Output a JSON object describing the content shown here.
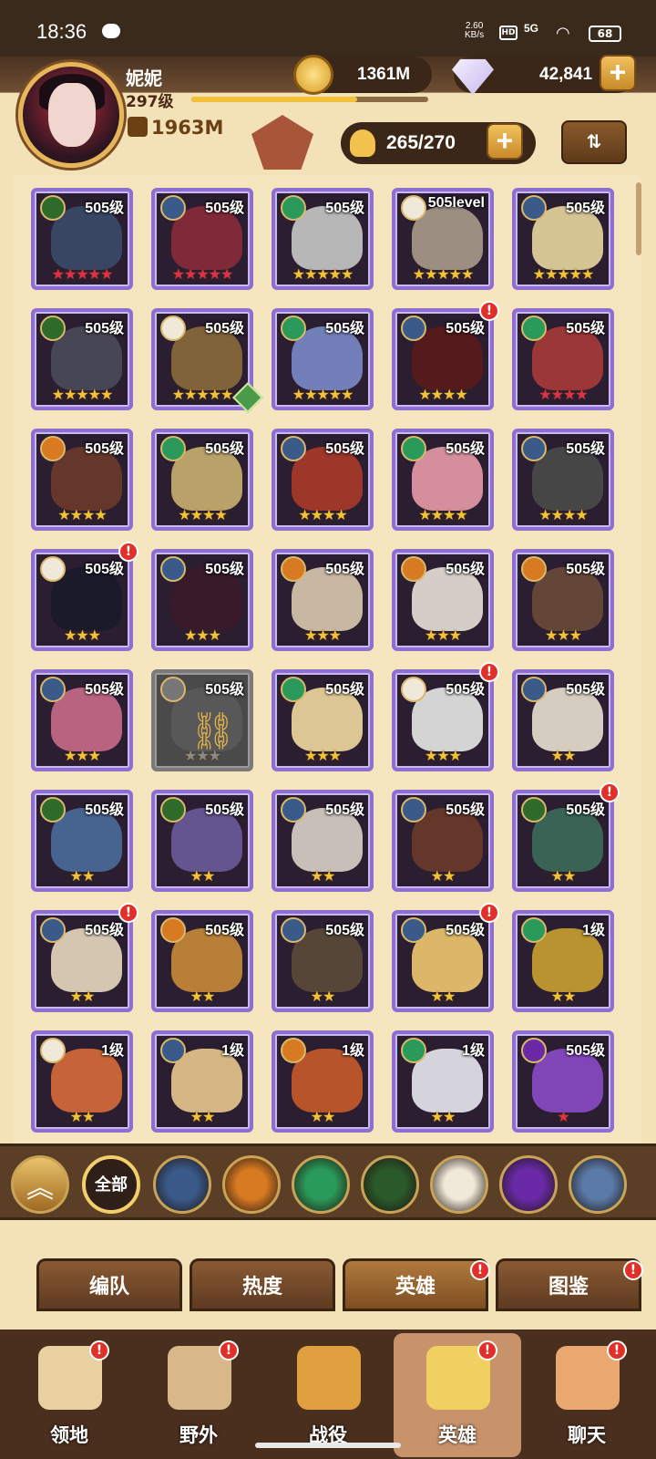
{
  "status_bar": {
    "time": "18:36",
    "net_speed": "2.60",
    "net_unit": "KB/s",
    "hd": "HD",
    "network": "5G",
    "battery": "68"
  },
  "player": {
    "name": "妮妮",
    "level": "297级",
    "exp_fraction": 0.7,
    "power": "1963M"
  },
  "resources": {
    "gold": "1361M",
    "diamonds": "42,841",
    "hero_count": "265/270"
  },
  "heroes": [
    {
      "level": "505级",
      "stars": "★★★★★",
      "star_color": "red",
      "faction": "forest",
      "color": "#3a4a6a",
      "alert": false
    },
    {
      "level": "505级",
      "stars": "★★★★★",
      "star_color": "red",
      "faction": "lightbearer",
      "color": "#8a2a3a",
      "alert": false
    },
    {
      "level": "505级",
      "stars": "★★★★★",
      "star_color": "gold",
      "faction": "wilder",
      "color": "#c8c8c8",
      "alert": false
    },
    {
      "level": "505level",
      "stars": "★★★★★",
      "star_color": "gold",
      "faction": "celestial",
      "color": "#a89a8a",
      "alert": false
    },
    {
      "level": "505级",
      "stars": "★★★★★",
      "star_color": "gold",
      "faction": "lightbearer",
      "color": "#e8d6a0",
      "alert": false
    },
    {
      "level": "505级",
      "stars": "★★★★★",
      "star_color": "gold",
      "faction": "forest",
      "color": "#4a4a5a",
      "alert": false
    },
    {
      "level": "505级",
      "stars": "★★★★★",
      "star_color": "gold",
      "faction": "celestial",
      "color": "#8a6a3a",
      "alert": false,
      "hourglass": true
    },
    {
      "level": "505级",
      "stars": "★★★★★",
      "star_color": "gold",
      "faction": "wilder",
      "color": "#7a8ac8",
      "alert": false
    },
    {
      "level": "505级",
      "stars": "★★★★",
      "star_color": "gold",
      "faction": "lightbearer",
      "color": "#5a1a1a",
      "alert": true
    },
    {
      "level": "505级",
      "stars": "★★★★",
      "star_color": "red",
      "faction": "wilder",
      "color": "#a83a3a",
      "alert": false
    },
    {
      "level": "505级",
      "stars": "★★★★",
      "star_color": "gold",
      "faction": "graveborn",
      "color": "#6a3a2a",
      "alert": false
    },
    {
      "level": "505级",
      "stars": "★★★★",
      "star_color": "gold",
      "faction": "wilder",
      "color": "#c8b070",
      "alert": false
    },
    {
      "level": "505级",
      "stars": "★★★★",
      "star_color": "gold",
      "faction": "lightbearer",
      "color": "#a83a2a",
      "alert": false
    },
    {
      "level": "505级",
      "stars": "★★★★",
      "star_color": "gold",
      "faction": "wilder",
      "color": "#e89aa8",
      "alert": false
    },
    {
      "level": "505级",
      "stars": "★★★★",
      "star_color": "gold",
      "faction": "lightbearer",
      "color": "#4a4a4a",
      "alert": false
    },
    {
      "level": "505级",
      "stars": "★★★",
      "star_color": "gold",
      "faction": "celestial",
      "color": "#1a1a2a",
      "alert": true
    },
    {
      "level": "505级",
      "stars": "★★★",
      "star_color": "gold",
      "faction": "lightbearer",
      "color": "#3a1a2a",
      "alert": false
    },
    {
      "level": "505级",
      "stars": "★★★",
      "star_color": "gold",
      "faction": "graveborn",
      "color": "#d8c8b0",
      "alert": false
    },
    {
      "level": "505级",
      "stars": "★★★",
      "star_color": "gold",
      "faction": "graveborn",
      "color": "#e8e0d8",
      "alert": false
    },
    {
      "level": "505级",
      "stars": "★★★",
      "star_color": "gold",
      "faction": "graveborn",
      "color": "#6a4a3a",
      "alert": false
    },
    {
      "level": "505级",
      "stars": "★★★",
      "star_color": "gold",
      "faction": "lightbearer",
      "color": "#c86a8a",
      "alert": false
    },
    {
      "level": "505级",
      "stars": "★★★",
      "star_color": "gray",
      "faction": "locked",
      "color": "#5a5a5a",
      "alert": false,
      "locked": true
    },
    {
      "level": "505级",
      "stars": "★★★",
      "star_color": "gold",
      "faction": "wilder",
      "color": "#f0d8a0",
      "alert": false
    },
    {
      "level": "505级",
      "stars": "★★★",
      "star_color": "gold",
      "faction": "celestial",
      "color": "#e8e8e8",
      "alert": true
    },
    {
      "level": "505级",
      "stars": "★★",
      "star_color": "gold",
      "faction": "lightbearer",
      "color": "#e8e0d0",
      "alert": false
    },
    {
      "level": "505级",
      "stars": "★★",
      "star_color": "gold",
      "faction": "forest",
      "color": "#4a6a9a",
      "alert": false
    },
    {
      "level": "505级",
      "stars": "★★",
      "star_color": "gold",
      "faction": "forest",
      "color": "#6a5a9a",
      "alert": false
    },
    {
      "level": "505级",
      "stars": "★★",
      "star_color": "gold",
      "faction": "lightbearer",
      "color": "#d8d0c8",
      "alert": false
    },
    {
      "level": "505级",
      "stars": "★★",
      "star_color": "gold",
      "faction": "lightbearer",
      "color": "#6a3a2a",
      "alert": false
    },
    {
      "level": "505级",
      "stars": "★★",
      "star_color": "gold",
      "faction": "forest",
      "color": "#3a6a5a",
      "alert": true
    },
    {
      "level": "505级",
      "stars": "★★",
      "star_color": "gold",
      "faction": "lightbearer",
      "color": "#e8d8c0",
      "alert": true
    },
    {
      "level": "505级",
      "stars": "★★",
      "star_color": "gold",
      "faction": "graveborn",
      "color": "#c88a3a",
      "alert": false
    },
    {
      "level": "505级",
      "stars": "★★",
      "star_color": "gold",
      "faction": "lightbearer",
      "color": "#5a4a3a",
      "alert": false
    },
    {
      "level": "505级",
      "stars": "★★",
      "star_color": "gold",
      "faction": "lightbearer",
      "color": "#f0c870",
      "alert": true
    },
    {
      "level": "1级",
      "stars": "★★",
      "star_color": "gold",
      "faction": "wilder",
      "color": "#c8a030",
      "alert": false
    },
    {
      "level": "1级",
      "stars": "★★",
      "star_color": "gold",
      "faction": "celestial",
      "color": "#d86a3a",
      "alert": false
    },
    {
      "level": "1级",
      "stars": "★★",
      "star_color": "gold",
      "faction": "lightbearer",
      "color": "#e8c890",
      "alert": false
    },
    {
      "level": "1级",
      "stars": "★★",
      "star_color": "gold",
      "faction": "graveborn",
      "color": "#c85a2a",
      "alert": false
    },
    {
      "level": "1级",
      "stars": "★★",
      "star_color": "gold",
      "faction": "wilder",
      "color": "#e8e8f0",
      "alert": false
    },
    {
      "level": "505级",
      "stars": "★",
      "star_color": "red",
      "faction": "hypogean",
      "color": "#8a4ac8",
      "alert": false
    }
  ],
  "filters": {
    "all_label": "全部",
    "factions": [
      {
        "name": "lightbearer",
        "color": "#3a5a8a"
      },
      {
        "name": "graveborn",
        "color": "#d87a22"
      },
      {
        "name": "wilder",
        "color": "#2a9a5a"
      },
      {
        "name": "forest",
        "color": "#2a5a2a"
      },
      {
        "name": "celestial",
        "color": "#f0e8d8"
      },
      {
        "name": "hypogean",
        "color": "#6a2aa8"
      },
      {
        "name": "dimensional",
        "color": "#5a7aa8"
      }
    ]
  },
  "sub_tabs": [
    {
      "label": "编队",
      "alert": false
    },
    {
      "label": "热度",
      "alert": false
    },
    {
      "label": "英雄",
      "alert": true,
      "active": true
    },
    {
      "label": "图鉴",
      "alert": true
    }
  ],
  "nav": [
    {
      "label": "领地",
      "alert": true,
      "icon": "castle-icon",
      "color": "#e8d0a0"
    },
    {
      "label": "野外",
      "alert": true,
      "icon": "scroll-map-icon",
      "color": "#d8b888"
    },
    {
      "label": "战役",
      "alert": false,
      "icon": "sword-crest-icon",
      "color": "#e0a040"
    },
    {
      "label": "英雄",
      "alert": true,
      "icon": "helmet-icon",
      "color": "#f0d060",
      "active": true
    },
    {
      "label": "聊天",
      "alert": true,
      "icon": "chat-bubble-icon",
      "color": "#e8a870"
    }
  ]
}
